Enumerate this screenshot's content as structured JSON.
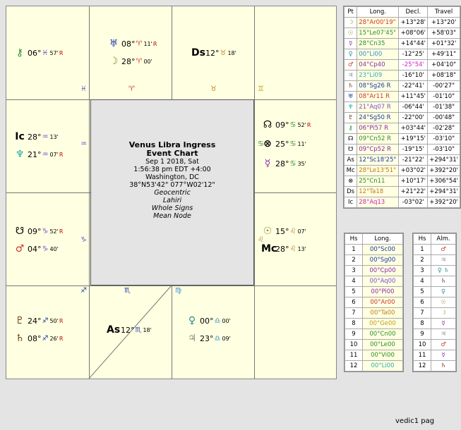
{
  "houses_chart": {
    "h1": {
      "sign": "♓",
      "planets": [
        {
          "glyph": "⚷",
          "color": "#2a8f2a",
          "deg": "06°",
          "sign": "♓",
          "color_s": "#7b4fd0",
          "min": "57'",
          "retro": "R"
        }
      ]
    },
    "h2": {
      "sign": "♈",
      "planets": [
        {
          "glyph": "♅",
          "color": "#1a3aa8",
          "deg": "08°",
          "sign": "♈",
          "color_s": "#d0362a",
          "min": "11'",
          "retro": "R"
        },
        {
          "glyph": "☽",
          "color": "#8a8a2a",
          "deg": "28°",
          "sign": "♈",
          "color_s": "#d0362a",
          "min": "00'",
          "retro": ""
        }
      ]
    },
    "h3": {
      "sign": "♉",
      "planets": [
        {
          "glyph": "Ds",
          "color": "#000",
          "deg": "12°",
          "sign": "♉",
          "color_s": "#c07a1e",
          "min": "18'",
          "retro": ""
        }
      ]
    },
    "h4": {
      "sign": "♊",
      "planets": []
    },
    "h12": {
      "sign": "♒",
      "planets": [
        {
          "glyph": "Ic",
          "color": "#000",
          "deg": "28°",
          "sign": "♒",
          "color_s": "#7b4fd0",
          "min": "13'",
          "retro": ""
        },
        {
          "glyph": "♆",
          "color": "#1aa8a8",
          "deg": "21°",
          "sign": "♒",
          "color_s": "#7b4fd0",
          "min": "07'",
          "retro": "R"
        }
      ]
    },
    "h5": {
      "sign": "♋",
      "planets": [
        {
          "glyph": "☊",
          "color": "#000",
          "deg": "09°",
          "sign": "♋",
          "color_s": "#2a8f2a",
          "min": "52'",
          "retro": "R"
        },
        {
          "glyph": "⊗",
          "color": "#000",
          "deg": "25°",
          "sign": "♋",
          "color_s": "#2a8f2a",
          "min": "11'",
          "retro": ""
        },
        {
          "glyph": "☿",
          "color": "#8a2ab0",
          "deg": "28°",
          "sign": "♋",
          "color_s": "#2a8f2a",
          "min": "35'",
          "retro": ""
        }
      ]
    },
    "h11": {
      "sign": "♑",
      "planets": [
        {
          "glyph": "☋",
          "color": "#000",
          "deg": "09°",
          "sign": "♑",
          "color_s": "#7b4fd0",
          "min": "52'",
          "retro": "R"
        },
        {
          "glyph": "♂",
          "color": "#d0362a",
          "deg": "04°",
          "sign": "♑",
          "color_s": "#7b4fd0",
          "min": "40'",
          "retro": ""
        }
      ]
    },
    "h6": {
      "sign": "♌",
      "planets": [
        {
          "glyph": "☉",
          "color": "#8a8a2a",
          "deg": "15°",
          "sign": "♌",
          "color_s": "#c07a1e",
          "min": "07'",
          "retro": ""
        },
        {
          "glyph": "Mc",
          "color": "#000",
          "deg": "28°",
          "sign": "♌",
          "color_s": "#c07a1e",
          "min": "13'",
          "retro": ""
        }
      ]
    },
    "h10": {
      "sign": "♐",
      "planets": [
        {
          "glyph": "♇",
          "color": "#6a3a1a",
          "deg": "24°",
          "sign": "♐",
          "color_s": "#1a3aa8",
          "min": "50'",
          "retro": "R"
        },
        {
          "glyph": "♄",
          "color": "#6a3a1a",
          "deg": "08°",
          "sign": "♐",
          "color_s": "#1a3aa8",
          "min": "26'",
          "retro": "R"
        }
      ]
    },
    "h9": {
      "sign": "♏",
      "planets": [
        {
          "glyph": "As",
          "color": "#000",
          "deg": "12°",
          "sign": "♏",
          "color_s": "#1a3aa8",
          "min": "18'",
          "retro": ""
        }
      ]
    },
    "h8": {
      "sign": "♍",
      "planets": [
        {
          "glyph": "♀",
          "color": "#2a8f8f",
          "deg": "00°",
          "sign": "♎",
          "color_s": "#2a8fd0",
          "min": "00'",
          "retro": ""
        },
        {
          "glyph": "♃",
          "color": "#8a8a8a",
          "deg": "23°",
          "sign": "♎",
          "color_s": "#2a8fd0",
          "min": "09'",
          "retro": ""
        }
      ]
    }
  },
  "center": {
    "title": "Venus Libra Ingress",
    "subtitle": "Event Chart",
    "date": "Sep 1 2018, Sat",
    "time": "1:56:38 pm  EDT +4:00",
    "place": "Washington, DC",
    "coords": "38°N53'42\" 077°W02'12\"",
    "opts": [
      "Geocentric",
      "Lahiri",
      "Whole Signs",
      "Mean Node"
    ]
  },
  "planets_table": {
    "headers": [
      "Pt",
      "Long.",
      "Decl.",
      "Travel"
    ],
    "rows": [
      {
        "g": "☽",
        "gc": "#8a8a2a",
        "long": "28°Ar00'19\"",
        "lc": "#d0362a",
        "decl": "+13°28'",
        "travel": "+13°20'"
      },
      {
        "g": "☉",
        "gc": "#8a8a2a",
        "long": "15°Le07'45\"",
        "lc": "#2a8f2a",
        "decl": "+08°06'",
        "travel": "+58'03\""
      },
      {
        "g": "☿",
        "gc": "#8a2ab0",
        "long": "28°Cn35",
        "lc": "#2a8f2a",
        "decl": "+14°44'",
        "travel": "+01°32'"
      },
      {
        "g": "♀",
        "gc": "#2a8f8f",
        "long": "00°Li00",
        "lc": "#2a8fd0",
        "decl": "-12°25'",
        "travel": "+49'11\""
      },
      {
        "g": "♂",
        "gc": "#d0362a",
        "long": "04°Cp40",
        "lc": "#8a2ab0",
        "decl": "-25°54'",
        "travel": "+04'10\""
      },
      {
        "g": "♃",
        "gc": "#8a8a8a",
        "long": "23°Li09",
        "lc": "#2ab0b0",
        "decl": "-16°10'",
        "travel": "+08'18\""
      },
      {
        "g": "♄",
        "gc": "#6a3a1a",
        "long": "08°Sg26 R",
        "lc": "#1a3aa8",
        "decl": "-22°41'",
        "travel": "-00'27\""
      },
      {
        "g": "♅",
        "gc": "#1a3aa8",
        "long": "08°Ar11 R",
        "lc": "#d0362a",
        "decl": "+11°45'",
        "travel": "-01'10\""
      },
      {
        "g": "♆",
        "gc": "#1aa8a8",
        "long": "21°Aq07 R",
        "lc": "#7b4fd0",
        "decl": "-06°44'",
        "travel": "-01'38\""
      },
      {
        "g": "♇",
        "gc": "#6a3a1a",
        "long": "24°Sg50 R",
        "lc": "#1a3aa8",
        "decl": "-22°00'",
        "travel": "-00'48\""
      },
      {
        "g": "⚷",
        "gc": "#2a8f2a",
        "long": "06°Pi57 R",
        "lc": "#8a2ab0",
        "decl": "+03°44'",
        "travel": "-02'28\""
      },
      {
        "g": "☊",
        "gc": "#000",
        "long": "09°Cn52 R",
        "lc": "#2a8f2a",
        "decl": "+19°15'",
        "travel": "-03'10\""
      },
      {
        "g": "☋",
        "gc": "#000",
        "long": "09°Cp52 R",
        "lc": "#8a2ab0",
        "decl": "-19°15'",
        "travel": "-03'10\""
      },
      {
        "g": "As",
        "gc": "#000",
        "long": "12°Sc18'25\"",
        "lc": "#1a3aa8",
        "decl": "-21°22'",
        "travel": "+294°31'"
      },
      {
        "g": "Mc",
        "gc": "#000",
        "long": "28°Le13'51\"",
        "lc": "#c07a1e",
        "decl": "+03°02'",
        "travel": "+392°20'"
      },
      {
        "g": "⊗",
        "gc": "#000",
        "long": "25°Cn11",
        "lc": "#2a8f2a",
        "decl": "+10°17'",
        "travel": "+306°54'"
      },
      {
        "g": "Ds",
        "gc": "#000",
        "long": "12°Ta18",
        "lc": "#c07a1e",
        "decl": "+21°22'",
        "travel": "+294°31'"
      },
      {
        "g": "Ic",
        "gc": "#000",
        "long": "28°Aq13",
        "lc": "#d020c0",
        "decl": "-03°02'",
        "travel": "+392°20'"
      }
    ]
  },
  "houses_table": {
    "headers": [
      "Hs",
      "Long."
    ],
    "rows": [
      {
        "h": "1",
        "v": "00°Sc00",
        "c": "#1a3aa8"
      },
      {
        "h": "2",
        "v": "00°Sg00",
        "c": "#1a3aa8"
      },
      {
        "h": "3",
        "v": "00°Cp00",
        "c": "#8a2ab0"
      },
      {
        "h": "4",
        "v": "00°Aq00",
        "c": "#7b4fd0"
      },
      {
        "h": "5",
        "v": "00°Pi00",
        "c": "#8a2ab0"
      },
      {
        "h": "6",
        "v": "00°Ar00",
        "c": "#d0362a"
      },
      {
        "h": "7",
        "v": "00°Ta00",
        "c": "#c07a1e"
      },
      {
        "h": "8",
        "v": "00°Ge00",
        "c": "#c0a020"
      },
      {
        "h": "9",
        "v": "00°Cn00",
        "c": "#2a8f2a"
      },
      {
        "h": "10",
        "v": "00°Le00",
        "c": "#2a8f2a"
      },
      {
        "h": "11",
        "v": "00°Vi00",
        "c": "#2a8f2a"
      },
      {
        "h": "12",
        "v": "00°Li00",
        "c": "#2ab0b0"
      }
    ]
  },
  "almuten_table": {
    "headers": [
      "Hs",
      "Alm."
    ],
    "rows": [
      {
        "h": "1",
        "g": "♂",
        "c": "#d0362a"
      },
      {
        "h": "2",
        "g": "♃",
        "c": "#8a8a8a"
      },
      {
        "h": "3",
        "g": "♀ ♄",
        "c": "#2a8f8f"
      },
      {
        "h": "4",
        "g": "♄",
        "c": "#6a3a1a"
      },
      {
        "h": "5",
        "g": "♀",
        "c": "#2a8f8f"
      },
      {
        "h": "6",
        "g": "☉",
        "c": "#8a8a2a"
      },
      {
        "h": "7",
        "g": "☽",
        "c": "#8a8a2a"
      },
      {
        "h": "8",
        "g": "☿",
        "c": "#8a2ab0"
      },
      {
        "h": "9",
        "g": "♃",
        "c": "#8a8a8a"
      },
      {
        "h": "10",
        "g": "♂",
        "c": "#d0362a"
      },
      {
        "h": "11",
        "g": "☿",
        "c": "#8a2ab0"
      },
      {
        "h": "12",
        "g": "♄",
        "c": "#6a3a1a"
      }
    ]
  },
  "footer": "vedic1 pag"
}
